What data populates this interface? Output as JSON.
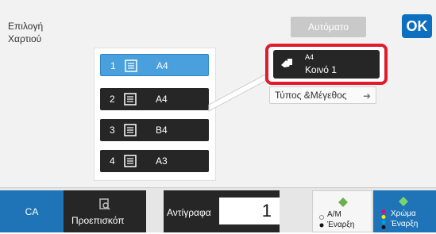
{
  "header": {
    "title": "Επιλογή Χαρτιού",
    "auto_label": "Αυτόματο",
    "ok_label": "OK"
  },
  "trays": [
    {
      "num": "1",
      "size": "A4",
      "selected": true
    },
    {
      "num": "2",
      "size": "A4",
      "selected": false
    },
    {
      "num": "3",
      "size": "B4",
      "selected": false
    },
    {
      "num": "4",
      "size": "A3",
      "selected": false
    }
  ],
  "paper_info": {
    "size": "A4",
    "type": "Κοινό 1",
    "type_size_button": "Τύπος &Μέγεθος"
  },
  "bottom_bar": {
    "ca_label": "CA",
    "preview_label": "Προεπισκόπ",
    "copies_label": "Αντίγραφα",
    "copies_value": "1",
    "bw_line1": "Α/Μ",
    "bw_line2": "Έναρξη",
    "color_line1": "Χρώμα",
    "color_line2": "Έναρξη"
  },
  "colors": {
    "accent": "#1e74b6",
    "selected_tray": "#4aa0dc",
    "highlight": "#e01b2c",
    "dark": "#262626"
  }
}
